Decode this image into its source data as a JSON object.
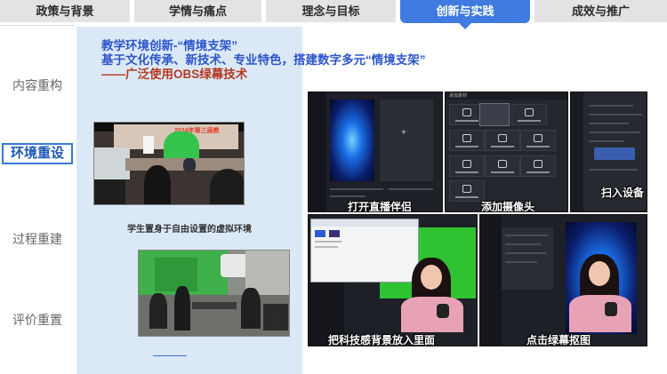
{
  "tabs": [
    {
      "label": "政策与背景",
      "active": false
    },
    {
      "label": "学情与痛点",
      "active": false
    },
    {
      "label": "理念与目标",
      "active": false
    },
    {
      "label": "创新与实践",
      "active": true
    },
    {
      "label": "成效与推广",
      "active": false
    }
  ],
  "nav": [
    {
      "label": "内容重构",
      "active": false
    },
    {
      "label": "环境重设",
      "active": true
    },
    {
      "label": "过程重建",
      "active": false
    },
    {
      "label": "评价重置",
      "active": false
    }
  ],
  "heading": {
    "line1": "教学环境创新-“情境支架”",
    "line2": "基于文化传承、新技术、专业特色，搭建数字多元“情境支架”",
    "line3": "——广泛使用OBS绿幕技术"
  },
  "photo_caption": "学生置身于自由设置的虚拟环境",
  "photo1_overlay": "2024年第三届教",
  "screenshots": [
    {
      "caption": "打开直播伴侣"
    },
    {
      "caption": "添加摄像头"
    },
    {
      "caption": "扫入设备"
    },
    {
      "caption": "把科技感背景放入里面"
    },
    {
      "caption": "点击绿幕抠图"
    }
  ],
  "obs_menu_title": "添加素材",
  "colors": {
    "accent": "#3f7be0",
    "panel": "#dbe9f7",
    "heading_blue": "#2d55c9",
    "heading_red": "#b53a24"
  }
}
